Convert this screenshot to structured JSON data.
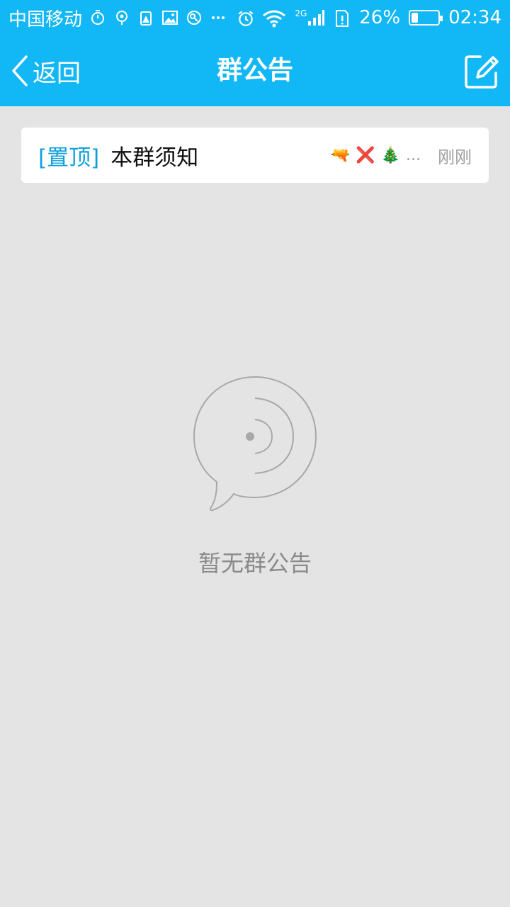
{
  "status_bar": {
    "carrier": "中国移动",
    "network": "2G",
    "battery_percent": "26%",
    "battery_level": 0.26,
    "time": "02:34",
    "icons": [
      "timer-icon",
      "location-icon",
      "alert-battery-icon",
      "image-icon",
      "app-icon",
      "more-icon",
      "alarm-icon",
      "wifi-icon",
      "signal-icon",
      "sim-alert-icon",
      "battery-icon"
    ]
  },
  "header": {
    "back_label": "返回",
    "title": "群公告"
  },
  "announcements": [
    {
      "pin_label": "[置顶]",
      "title": "本群须知",
      "author_emojis": [
        "🔫",
        "❌",
        "🎄"
      ],
      "ellipsis": "...",
      "time": "刚刚"
    }
  ],
  "empty_state": {
    "text": "暂无群公告"
  },
  "colors": {
    "brand": "#12b7f5",
    "pin": "#12a0dc",
    "background": "#e4e4e4"
  }
}
